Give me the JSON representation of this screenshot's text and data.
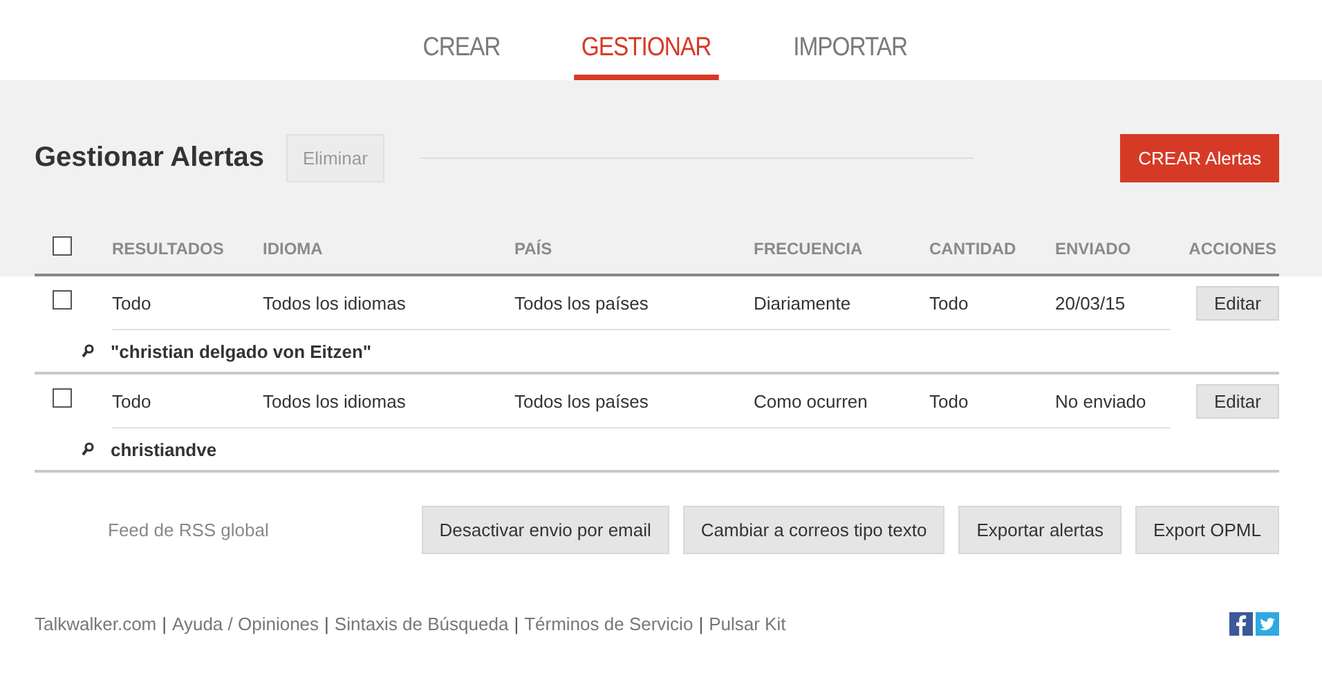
{
  "tabs": [
    {
      "label": "CREAR",
      "selected": false
    },
    {
      "label": "GESTIONAR",
      "selected": true
    },
    {
      "label": "IMPORTAR",
      "selected": false
    }
  ],
  "title": "Gestionar Alertas",
  "delete_button": {
    "label": "Eliminar",
    "disabled": true
  },
  "create_button": "CREAR Alertas",
  "table": {
    "select_all": {
      "checked": false
    },
    "columns": [
      "RESULTADOS",
      "IDIOMA",
      "PAÍS",
      "FRECUENCIA",
      "CANTIDAD",
      "ENVIADO",
      "ACCIONES"
    ],
    "rows": [
      {
        "checked": false,
        "cells": [
          "Todo",
          "Todos los idiomas",
          "Todos los países",
          "Diariamente",
          "Todo",
          "20/03/15"
        ],
        "action": "Editar",
        "query": "\"christian delgado von Eitzen\""
      },
      {
        "checked": false,
        "cells": [
          "Todo",
          "Todos los idiomas",
          "Todos los países",
          "Como ocurren",
          "Todo",
          "No enviado"
        ],
        "action": "Editar",
        "query": "christiandve"
      }
    ]
  },
  "rss_link": "Feed de RSS global",
  "actions": [
    "Desactivar envio por email",
    "Cambiar a correos tipo texto",
    "Exportar alertas",
    "Export OPML"
  ],
  "footer_links": [
    "Talkwalker.com",
    "Ayuda / Opiniones",
    "Sintaxis de Búsqueda",
    "Términos de Servicio",
    "Pulsar Kit"
  ],
  "footer_separator": "|"
}
